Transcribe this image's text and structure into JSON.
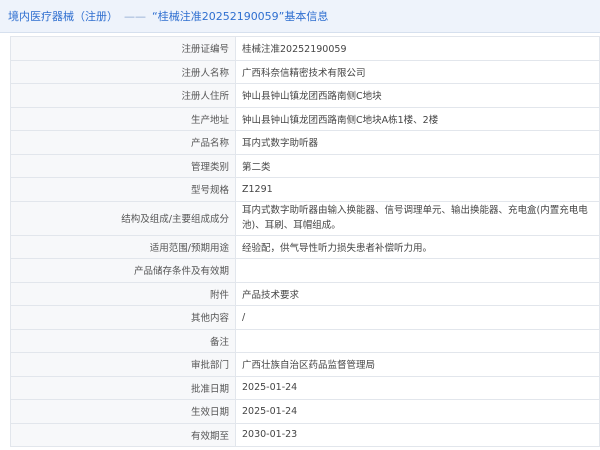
{
  "header": {
    "section": "境内医疗器械（注册）",
    "separator": "——",
    "title": "“桂械注准20252190059”基本信息"
  },
  "rows": [
    {
      "label": "注册证编号",
      "value": "桂械注准20252190059"
    },
    {
      "label": "注册人名称",
      "value": "广西科奈信精密技术有限公司"
    },
    {
      "label": "注册人住所",
      "value": "钟山县钟山镇龙团西路南侧C地块"
    },
    {
      "label": "生产地址",
      "value": "钟山县钟山镇龙团西路南侧C地块A栋1楼、2楼"
    },
    {
      "label": "产品名称",
      "value": "耳内式数字助听器"
    },
    {
      "label": "管理类别",
      "value": "第二类"
    },
    {
      "label": "型号规格",
      "value": "Z1291"
    },
    {
      "label": "结构及组成/主要组成成分",
      "value": "耳内式数字助听器由输入换能器、信号调理单元、输出换能器、充电盒(内置充电电池)、耳刷、耳帽组成。"
    },
    {
      "label": "适用范围/预期用途",
      "value": "经验配，供气导性听力损失患者补偿听力用。"
    },
    {
      "label": "产品储存条件及有效期",
      "value": ""
    },
    {
      "label": "附件",
      "value": "产品技术要求"
    },
    {
      "label": "其他内容",
      "value": "/"
    },
    {
      "label": "备注",
      "value": ""
    },
    {
      "label": "审批部门",
      "value": "广西壮族自治区药品监督管理局"
    },
    {
      "label": "批准日期",
      "value": "2025-01-24"
    },
    {
      "label": "生效日期",
      "value": "2025-01-24"
    },
    {
      "label": "有效期至",
      "value": "2030-01-23"
    }
  ]
}
